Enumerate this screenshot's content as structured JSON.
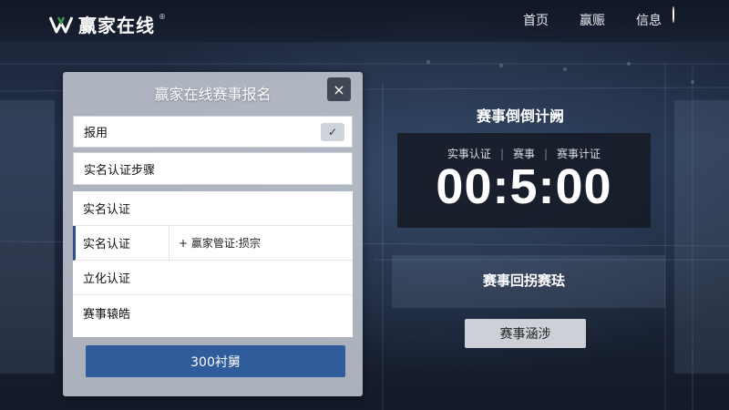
{
  "header": {
    "logo_text": "赢家在线",
    "logo_reg": "®",
    "nav": [
      "首页",
      "赢赈",
      "信息"
    ]
  },
  "dialog": {
    "title": "赢家在线赛事报名",
    "close_icon": "×",
    "select_value": "报用",
    "check_icon": "✓",
    "steps_value": "实名认证步骤",
    "list": [
      {
        "label": "实名认证"
      },
      {
        "label": "实名认证",
        "detail": "+ 赢家管证:损宗"
      },
      {
        "label": "立化认证"
      },
      {
        "label": "赛事辕皓"
      }
    ],
    "submit_label": "300衬舅"
  },
  "countdown": {
    "title": "赛事倒倒计阙",
    "labels": [
      "实事认证",
      "赛事",
      "赛事计证"
    ],
    "time": "00:5:00"
  },
  "review": {
    "title": "赛事回拐赛珐",
    "button_label": "赛事涵涉"
  },
  "colors": {
    "primary_button": "#2f5c9b",
    "badge": "#e64b3b",
    "dialog_bg": "#cdd2da"
  }
}
